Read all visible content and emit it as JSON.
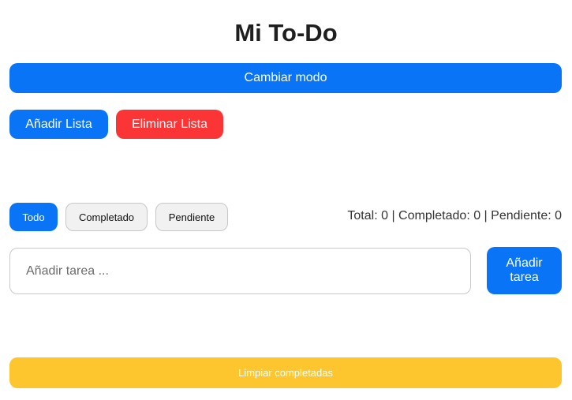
{
  "app": {
    "title": "Mi To-Do"
  },
  "toolbar": {
    "mode_label": "Cambiar modo",
    "add_list_label": "Añadir Lista",
    "delete_list_label": "Eliminar Lista"
  },
  "filters": {
    "all_label": "Todo",
    "completed_label": "Completado",
    "pending_label": "Pendiente",
    "active": "Todo"
  },
  "stats": {
    "text": "Total: 0 | Completado: 0 | Pendiente: 0",
    "total": 0,
    "completed": 0,
    "pending": 0
  },
  "task_form": {
    "placeholder": "Añadir tarea ...",
    "value": "",
    "add_label": "Añadir tarea"
  },
  "footer": {
    "clear_label": "Limpiar completadas"
  },
  "colors": {
    "primary": "#0a74f7",
    "danger": "#fb3435",
    "warning": "#fdc62f",
    "neutral": "#f1f1f1"
  }
}
